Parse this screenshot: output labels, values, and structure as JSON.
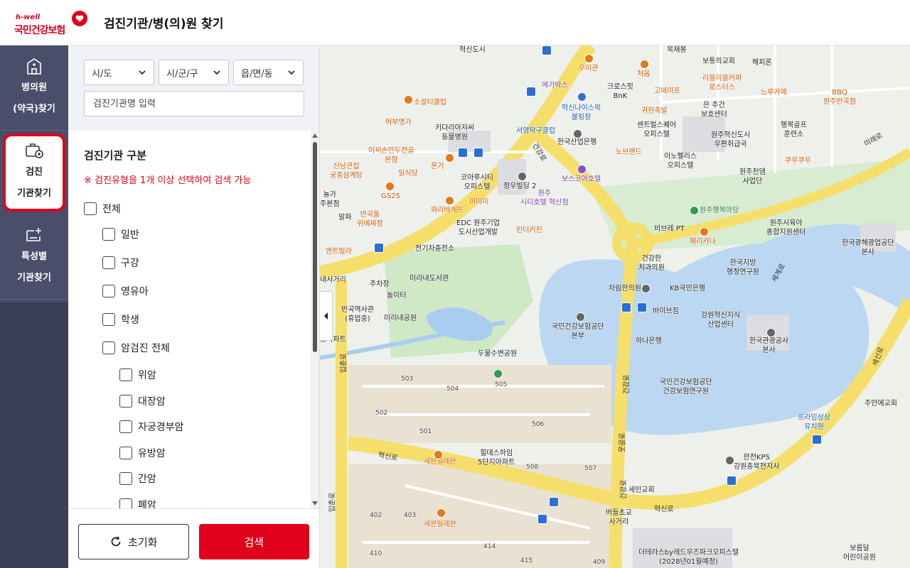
{
  "header": {
    "logo_small": "h-well",
    "logo_brand": "국민건강보험",
    "title": "검진기관/병(의)원 찾기"
  },
  "nav": {
    "items": [
      {
        "label_line1": "병의원",
        "label_line2": "(약국)찾기",
        "icon": "hospital-icon"
      },
      {
        "label_line1": "검진",
        "label_line2": "기관찾기",
        "icon": "checkup-bag-icon"
      },
      {
        "label_line1": "특성별",
        "label_line2": "기관찾기",
        "icon": "screen-plus-icon"
      }
    ]
  },
  "filters": {
    "sido": "시/도",
    "sigungu": "시/군/구",
    "eupmyeon": "읍/면/동",
    "name_placeholder": "검진기관명 입력"
  },
  "checkup": {
    "section_title": "검진기관 구분",
    "notice": "※ 검진유형을 1개 이상 선택하여 검색 가능",
    "all": "전체",
    "types": [
      "일반",
      "구강",
      "영유아",
      "학생",
      "암검진 전체"
    ],
    "cancers": [
      "위암",
      "대장암",
      "자궁경부암",
      "유방암",
      "간암",
      "폐암"
    ]
  },
  "buttons": {
    "reset": "초기화",
    "search": "검색"
  },
  "map": {
    "labels": [
      {
        "text": "혁신도시",
        "cls": ""
      },
      {
        "text": "우미관",
        "cls": "orange"
      },
      {
        "text": "처음",
        "cls": "orange"
      },
      {
        "text": "메가박스",
        "cls": "purple"
      },
      {
        "text": "크로스핏\nBnK",
        "cls": ""
      },
      {
        "text": "고에이프",
        "cls": "orange"
      },
      {
        "text": "리을리을커피\n로스터스",
        "cls": "orange"
      },
      {
        "text": "느루카메",
        "cls": "orange"
      },
      {
        "text": "해피론",
        "cls": ""
      },
      {
        "text": "BBQ\n원주반곡점",
        "cls": "orange"
      },
      {
        "text": "보통의교회",
        "cls": ""
      },
      {
        "text": "소설티클럽",
        "cls": "orange"
      },
      {
        "text": "혁신나이스락\n볼링장",
        "cls": "blue"
      },
      {
        "text": "귀한족발",
        "cls": "orange"
      },
      {
        "text": "은 주간\n보호센터",
        "cls": ""
      },
      {
        "text": "행복골프\n훈련소",
        "cls": ""
      },
      {
        "text": "어부명가",
        "cls": "orange"
      },
      {
        "text": "키다리아저씨\n동물병원",
        "cls": ""
      },
      {
        "text": "서영탁구클럽",
        "cls": "blue"
      },
      {
        "text": "한국산업은행",
        "cls": ""
      },
      {
        "text": "센트럴스퀘어\n오피스텔",
        "cls": ""
      },
      {
        "text": "원주혁신도시\n우편취급국",
        "cls": ""
      },
      {
        "text": "이씨손만두전골\n본점",
        "cls": "orange"
      },
      {
        "text": "노브랜드",
        "cls": "orange"
      },
      {
        "text": "이노펠리스\n오피스텔",
        "cls": ""
      },
      {
        "text": "쿠우쿠우",
        "cls": "orange"
      },
      {
        "text": "온기",
        "cls": "orange"
      },
      {
        "text": "일식당",
        "cls": "orange"
      },
      {
        "text": "신남큰집\n궁중삼계탕",
        "cls": "orange"
      },
      {
        "text": "코아루시티\n오피스텔",
        "cls": ""
      },
      {
        "text": "정우빌딩 2",
        "cls": ""
      },
      {
        "text": "보스코아호텔",
        "cls": "purple"
      },
      {
        "text": "원주천댐\n사업단",
        "cls": ""
      },
      {
        "text": "원주\n시티호텔 혁신점",
        "cls": "purple"
      },
      {
        "text": "GS25",
        "cls": "orange"
      },
      {
        "text": "미미미",
        "cls": "orange"
      },
      {
        "text": "파리바게뜨",
        "cls": "orange"
      },
      {
        "text": "원주행복마당",
        "cls": "green"
      },
      {
        "text": "반곡돌\n위에짜장",
        "cls": "orange"
      },
      {
        "text": "EDC 원주기업\n도시산업개발",
        "cls": ""
      },
      {
        "text": "인더키친",
        "cls": "orange"
      },
      {
        "text": "비브레 PT",
        "cls": ""
      },
      {
        "text": "원주시육아\n종합지원센터",
        "cls": ""
      },
      {
        "text": "페리카나",
        "cls": "orange"
      },
      {
        "text": "한국광해광업공단\n본사",
        "cls": ""
      },
      {
        "text": "앤트빌라",
        "cls": "orange"
      },
      {
        "text": "전기차충전소",
        "cls": ""
      },
      {
        "text": "건강한\n치과의원",
        "cls": ""
      },
      {
        "text": "한국지방\n행정연구원",
        "cls": ""
      },
      {
        "text": "주차장",
        "cls": ""
      },
      {
        "text": "미리내도서관",
        "cls": ""
      },
      {
        "text": "차림한의원",
        "cls": ""
      },
      {
        "text": "KB국민은행",
        "cls": ""
      },
      {
        "text": "반곡역사관\n(휴업중)",
        "cls": ""
      },
      {
        "text": "미리내공원",
        "cls": ""
      },
      {
        "text": "바이브짐",
        "cls": ""
      },
      {
        "text": "강원혁신지식\n산업센터",
        "cls": ""
      },
      {
        "text": "국민건강보험공단\n본부",
        "cls": ""
      },
      {
        "text": "하나은행",
        "cls": ""
      },
      {
        "text": "한국관광공사\n본사",
        "cls": ""
      },
      {
        "text": "두물수변공원",
        "cls": ""
      },
      {
        "text": "국민건강보험공단\n건강보험연구원",
        "cls": ""
      },
      {
        "text": "주안에교회",
        "cls": ""
      },
      {
        "text": "프라임상상\n유치원",
        "cls": "blue"
      },
      {
        "text": "힐데스하임\n5단지아파트",
        "cls": ""
      },
      {
        "text": "세븐일레븐",
        "cls": "orange"
      },
      {
        "text": "한전KPS\n강원충북전지사",
        "cls": ""
      },
      {
        "text": "세인교회",
        "cls": ""
      },
      {
        "text": "버들초교\n사거리",
        "cls": ""
      },
      {
        "text": "세븐일레븐",
        "cls": "orange"
      },
      {
        "text": "더테라스by레드우즈파크오피스텔\n(2028년01월예정)",
        "cls": ""
      },
      {
        "text": "보름달\n어린이공원",
        "cls": ""
      },
      {
        "text": "농가\n주본점",
        "cls": ""
      },
      {
        "text": "알파",
        "cls": ""
      },
      {
        "text": "내사거리",
        "cls": ""
      },
      {
        "text": "놀이터",
        "cls": ""
      },
      {
        "text": "롱아파트",
        "cls": ""
      },
      {
        "text": "묵재봉",
        "cls": ""
      }
    ],
    "roads": [
      "건강로",
      "혁신로",
      "혁신로",
      "미래로",
      "세계로",
      "입춘로",
      "입춘로",
      "건강로",
      "건강로",
      "웃골로",
      "세신로"
    ],
    "numbers": [
      "503",
      "504",
      "505",
      "502",
      "501",
      "506",
      "508",
      "507",
      "402",
      "403",
      "414",
      "415",
      "409",
      "410"
    ]
  }
}
